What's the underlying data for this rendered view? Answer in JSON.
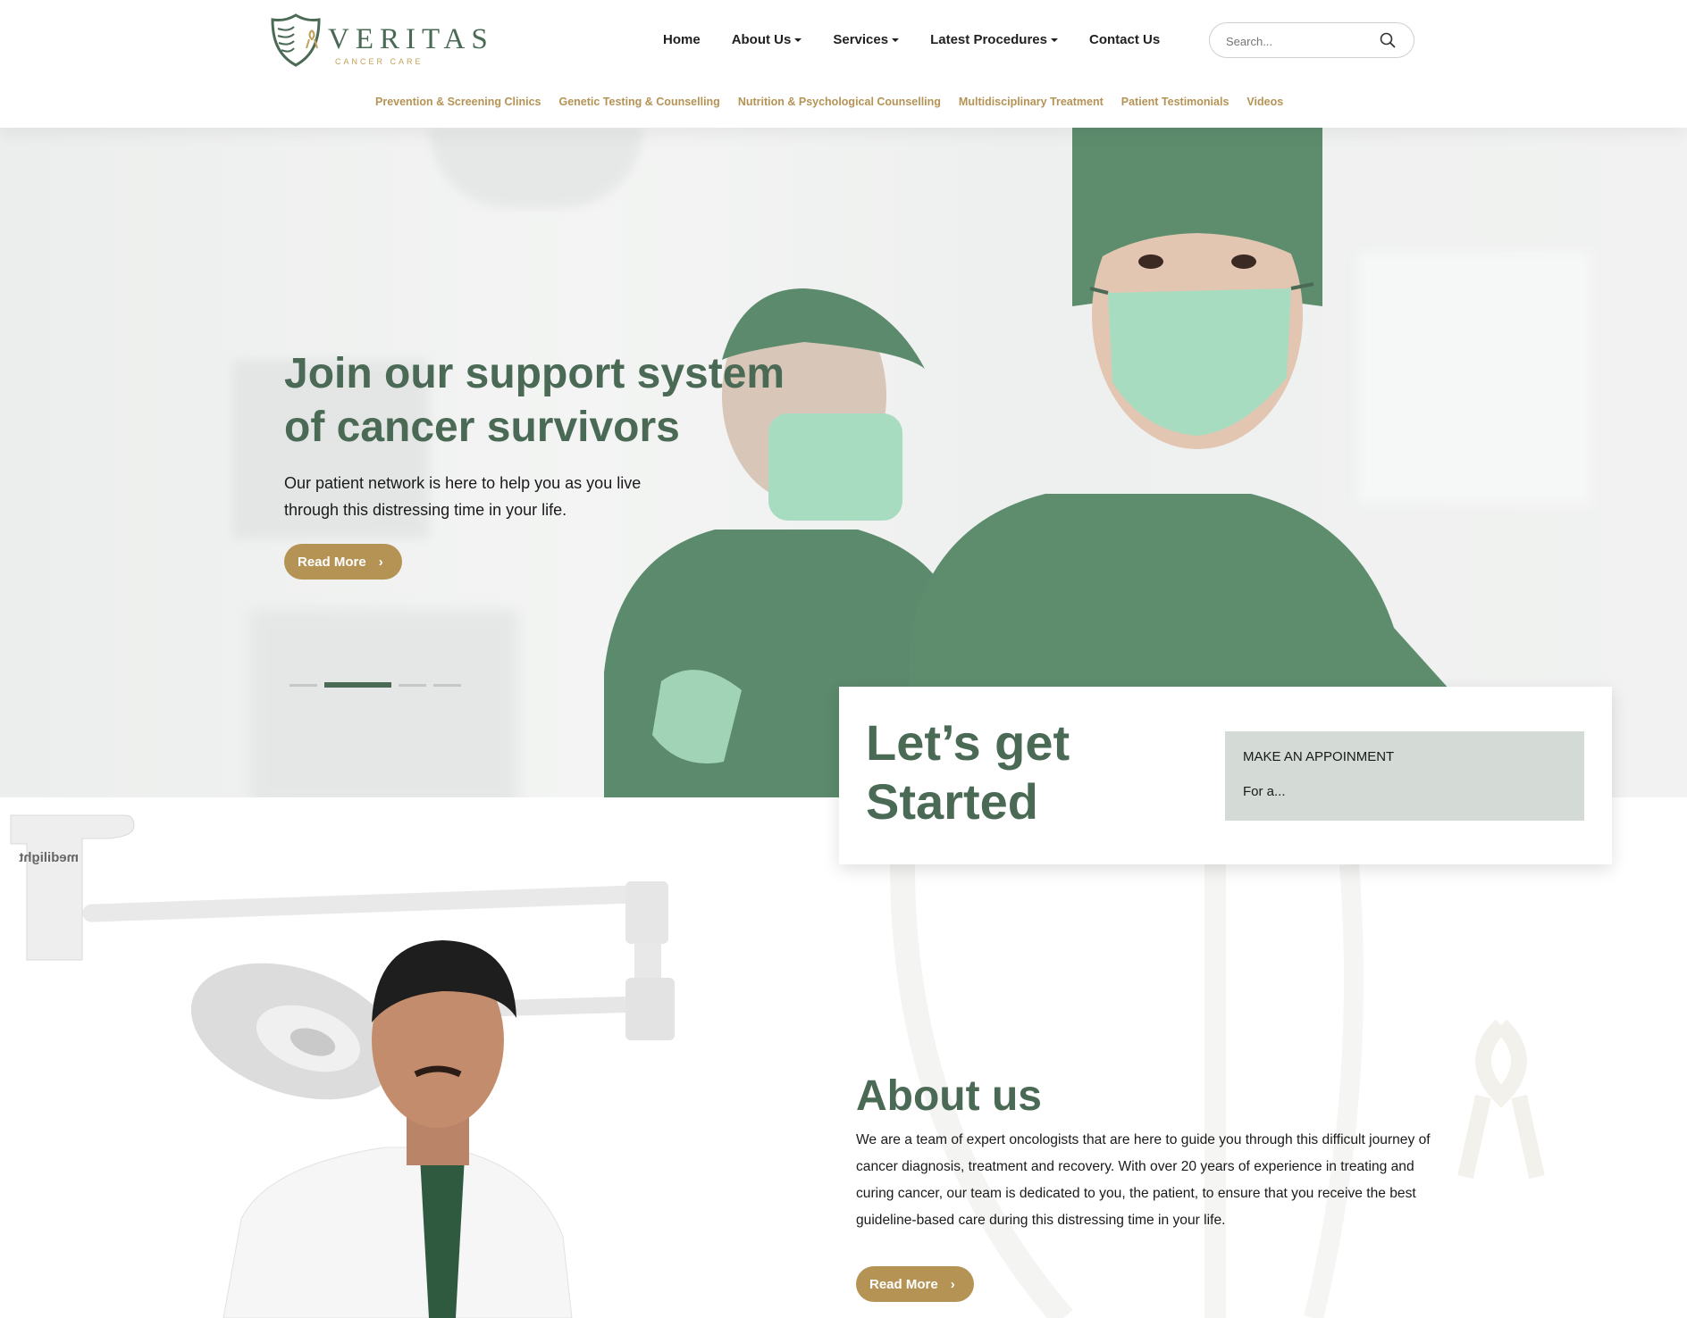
{
  "brand": {
    "name": "VERITAS",
    "tagline": "CANCER CARE",
    "colors": {
      "primary_green": "#4a6a56",
      "gold": "#b49355",
      "card_box": "#d4dbd7"
    }
  },
  "main_nav": [
    {
      "label": "Home",
      "dropdown": false
    },
    {
      "label": "About Us",
      "dropdown": true
    },
    {
      "label": "Services",
      "dropdown": true
    },
    {
      "label": "Latest Procedures",
      "dropdown": true
    },
    {
      "label": "Contact Us",
      "dropdown": false
    }
  ],
  "search": {
    "placeholder": "Search...",
    "icon": "search-icon"
  },
  "sub_nav": [
    "Prevention & Screening Clinics",
    "Genetic Testing & Counselling",
    "Nutrition & Psychological Counselling",
    "Multidisciplinary Treatment",
    "Patient Testimonials",
    "Videos"
  ],
  "hero": {
    "title_line1": "Join our support system",
    "title_line2": "of cancer survivors",
    "text": "Our patient network is here to help you as you live through this distressing time in your life.",
    "button": "Read More",
    "slides_total": 4,
    "active_slide": 2
  },
  "get_started": {
    "title_line1": "Let’s get",
    "title_line2": "Started",
    "box_title": "MAKE AN APPOINMENT",
    "box_sub": "For a..."
  },
  "about": {
    "title": "About us",
    "text": "We are a team of expert oncologists that are here to guide you through this difficult journey of cancer diagnosis, treatment and recovery. With over 20 years of experience in treating and curing cancer, our team is dedicated to you, the patient, to ensure that you receive the best guideline-based care during this distressing time in your life.",
    "button": "Read More",
    "lamp_label": "medilight"
  }
}
